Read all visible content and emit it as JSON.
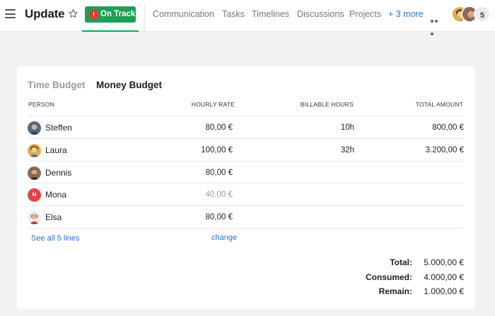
{
  "header": {
    "title": "Update",
    "status_badge": "On Track",
    "status_dot": "!",
    "nav": [
      "Communication",
      "Tasks",
      "Timelines",
      "Discussions",
      "Projects"
    ],
    "more_link": "+ 3 more",
    "member_count": "5"
  },
  "card": {
    "tabs": [
      "Time Budget",
      "Money Budget"
    ],
    "active_tab": "Money Budget",
    "columns": {
      "person": "PERSON",
      "hourly_rate": "HOURLY RATE",
      "billable_hours": "BILLABLE HOURS",
      "total_amount": "TOTAL AMOUNT"
    },
    "rows": [
      {
        "name": "Steffen",
        "rate": "80,00 €",
        "hours": "10h",
        "amount": "800,00 €"
      },
      {
        "name": "Laura",
        "rate": "100,00 €",
        "hours": "32h",
        "amount": "3.200,00 €"
      },
      {
        "name": "Dennis",
        "rate": "80,00 €",
        "hours": "",
        "amount": ""
      },
      {
        "name": "Mona",
        "rate": "40,00 €",
        "hours": "",
        "amount": "",
        "avatar_initial": "M"
      },
      {
        "name": "Elsa",
        "rate": "80,00 €",
        "hours": "",
        "amount": ""
      }
    ],
    "see_all_link": "See all 5 lines",
    "change_link": "change",
    "totals": {
      "total_label": "Total:",
      "total_value": "5.000,00 €",
      "consumed_label": "Consumed:",
      "consumed_value": "4.000,00 €",
      "remain_label": "Remain:",
      "remain_value": "1.000,00 €"
    }
  },
  "colors": {
    "status_green": "#1f9d55",
    "status_dot_red": "#e53935",
    "link_blue": "#2b6fd6",
    "background": "#f2f2f4"
  }
}
